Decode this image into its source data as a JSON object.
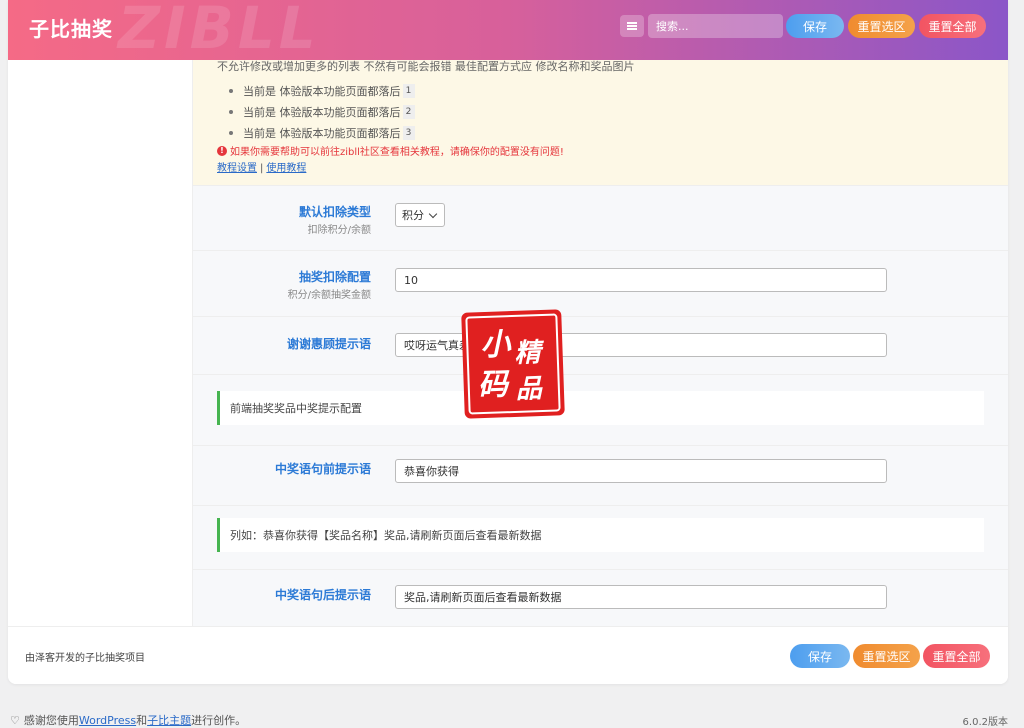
{
  "header": {
    "logo": "子比抽奖",
    "watermark": "ZIBLL",
    "search_placeholder": "搜索...",
    "save_label": "保存",
    "reset_section_label": "重置选区",
    "reset_all_label": "重置全部"
  },
  "notice": {
    "top_line": "不允许修改或增加更多的列表 不然有可能会报错 最佳配置方式应 修改名称和奖品图片",
    "items": [
      {
        "text": "当前是 体验版本功能页面都落后",
        "num": "1"
      },
      {
        "text": "当前是 体验版本功能页面都落后",
        "num": "2"
      },
      {
        "text": "当前是 体验版本功能页面都落后",
        "num": "3"
      }
    ],
    "warning": "如果你需要帮助可以前往zibll社区查看相关教程，请确保你的配置没有问题!",
    "link_tutorial": "教程设置",
    "link_separator": "|",
    "link_usage": "使用教程"
  },
  "fields": {
    "deduct_type": {
      "label": "默认扣除类型",
      "sub": "扣除积分/余额",
      "value": "积分"
    },
    "deduct_config": {
      "label": "抽奖扣除配置",
      "sub": "积分/余额抽奖金额",
      "value": "10"
    },
    "thanks_tip": {
      "label": "谢谢惠顾提示语",
      "value": "哎呀运气真差"
    },
    "win_prefix": {
      "label": "中奖语句前提示语",
      "value": "恭喜你获得"
    },
    "win_suffix": {
      "label": "中奖语句后提示语",
      "value": "奖品,请刷新页面后查看最新数据"
    }
  },
  "sections": {
    "frontend_win": "前端抽奖奖品中奖提示配置",
    "example": "列如：恭喜你获得【奖品名称】奖品,请刷新页面后查看最新数据"
  },
  "footer": {
    "credit": "由泽客开发的子比抽奖项目",
    "save_label": "保存",
    "reset_section_label": "重置选区",
    "reset_all_label": "重置全部"
  },
  "bottom": {
    "thanks_prefix": "感谢您使用",
    "wordpress": "WordPress",
    "and": "和",
    "theme": "子比主题",
    "suffix": "进行创作。",
    "version": "6.0.2版本"
  },
  "seal": {
    "c1": "小",
    "c2": "精",
    "c3": "码",
    "c4": "品"
  },
  "colors": {
    "accent": "#2c7ad6",
    "save": "#4d9eef",
    "reset_section": "#f08b2f",
    "reset_all": "#f25462",
    "section_bar": "#46b450"
  }
}
